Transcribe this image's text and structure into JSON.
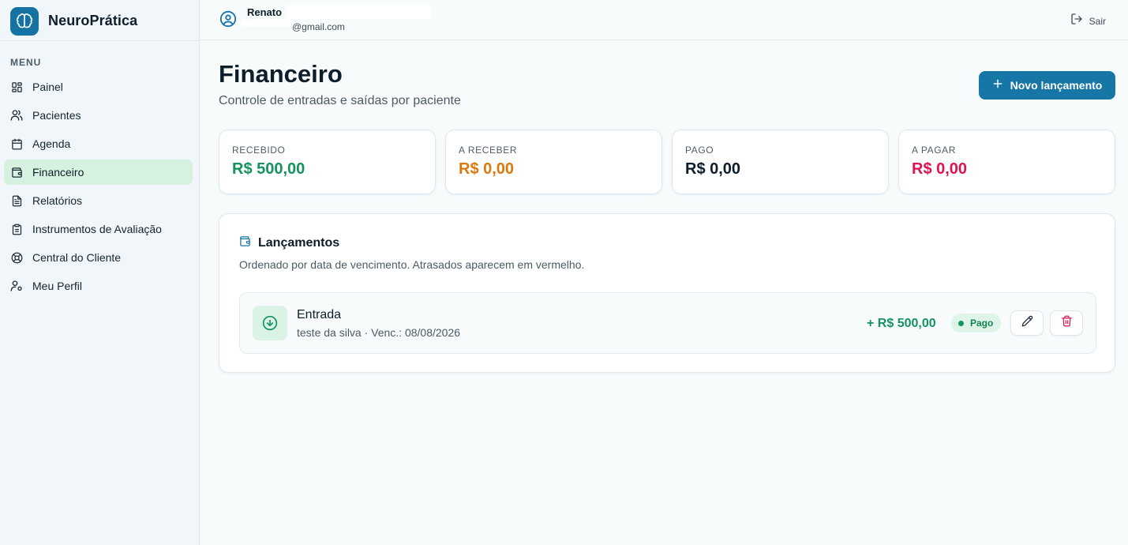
{
  "brand": {
    "name": "NeuroPrática"
  },
  "sidebar": {
    "menu_heading": "MENU",
    "items": [
      {
        "label": "Painel",
        "icon": "grid-icon"
      },
      {
        "label": "Pacientes",
        "icon": "users-icon"
      },
      {
        "label": "Agenda",
        "icon": "calendar-icon"
      },
      {
        "label": "Financeiro",
        "icon": "wallet-icon",
        "active": true
      },
      {
        "label": "Relatórios",
        "icon": "file-text-icon"
      },
      {
        "label": "Instrumentos de Avaliação",
        "icon": "clipboard-icon"
      },
      {
        "label": "Central do Cliente",
        "icon": "lifebuoy-icon"
      },
      {
        "label": "Meu Perfil",
        "icon": "user-cog-icon"
      }
    ]
  },
  "header": {
    "user_name": "Renato",
    "user_email": "@gmail.com",
    "logout_label": "Sair"
  },
  "page": {
    "title": "Financeiro",
    "subtitle": "Controle de entradas e saídas por paciente",
    "new_button_label": "Novo lançamento"
  },
  "stats": [
    {
      "label": "RECEBIDO",
      "value": "R$ 500,00",
      "color": "#15935e"
    },
    {
      "label": "A RECEBER",
      "value": "R$ 0,00",
      "color": "#d97a0c"
    },
    {
      "label": "PAGO",
      "value": "R$ 0,00",
      "color": "#0d1d2a"
    },
    {
      "label": "A PAGAR",
      "value": "R$ 0,00",
      "color": "#dc1450"
    }
  ],
  "entries_panel": {
    "title": "Lançamentos",
    "description": "Ordenado por data de vencimento. Atrasados aparecem em vermelho.",
    "entries": [
      {
        "type": "Entrada",
        "details": "teste da silva · Venc.: 08/08/2026",
        "amount": "+ R$ 500,00",
        "status": "Pago"
      }
    ]
  },
  "colors": {
    "primary": "#1676a6",
    "active_nav_bg": "#d6f1df",
    "success": "#15935e",
    "danger": "#dc1450"
  }
}
